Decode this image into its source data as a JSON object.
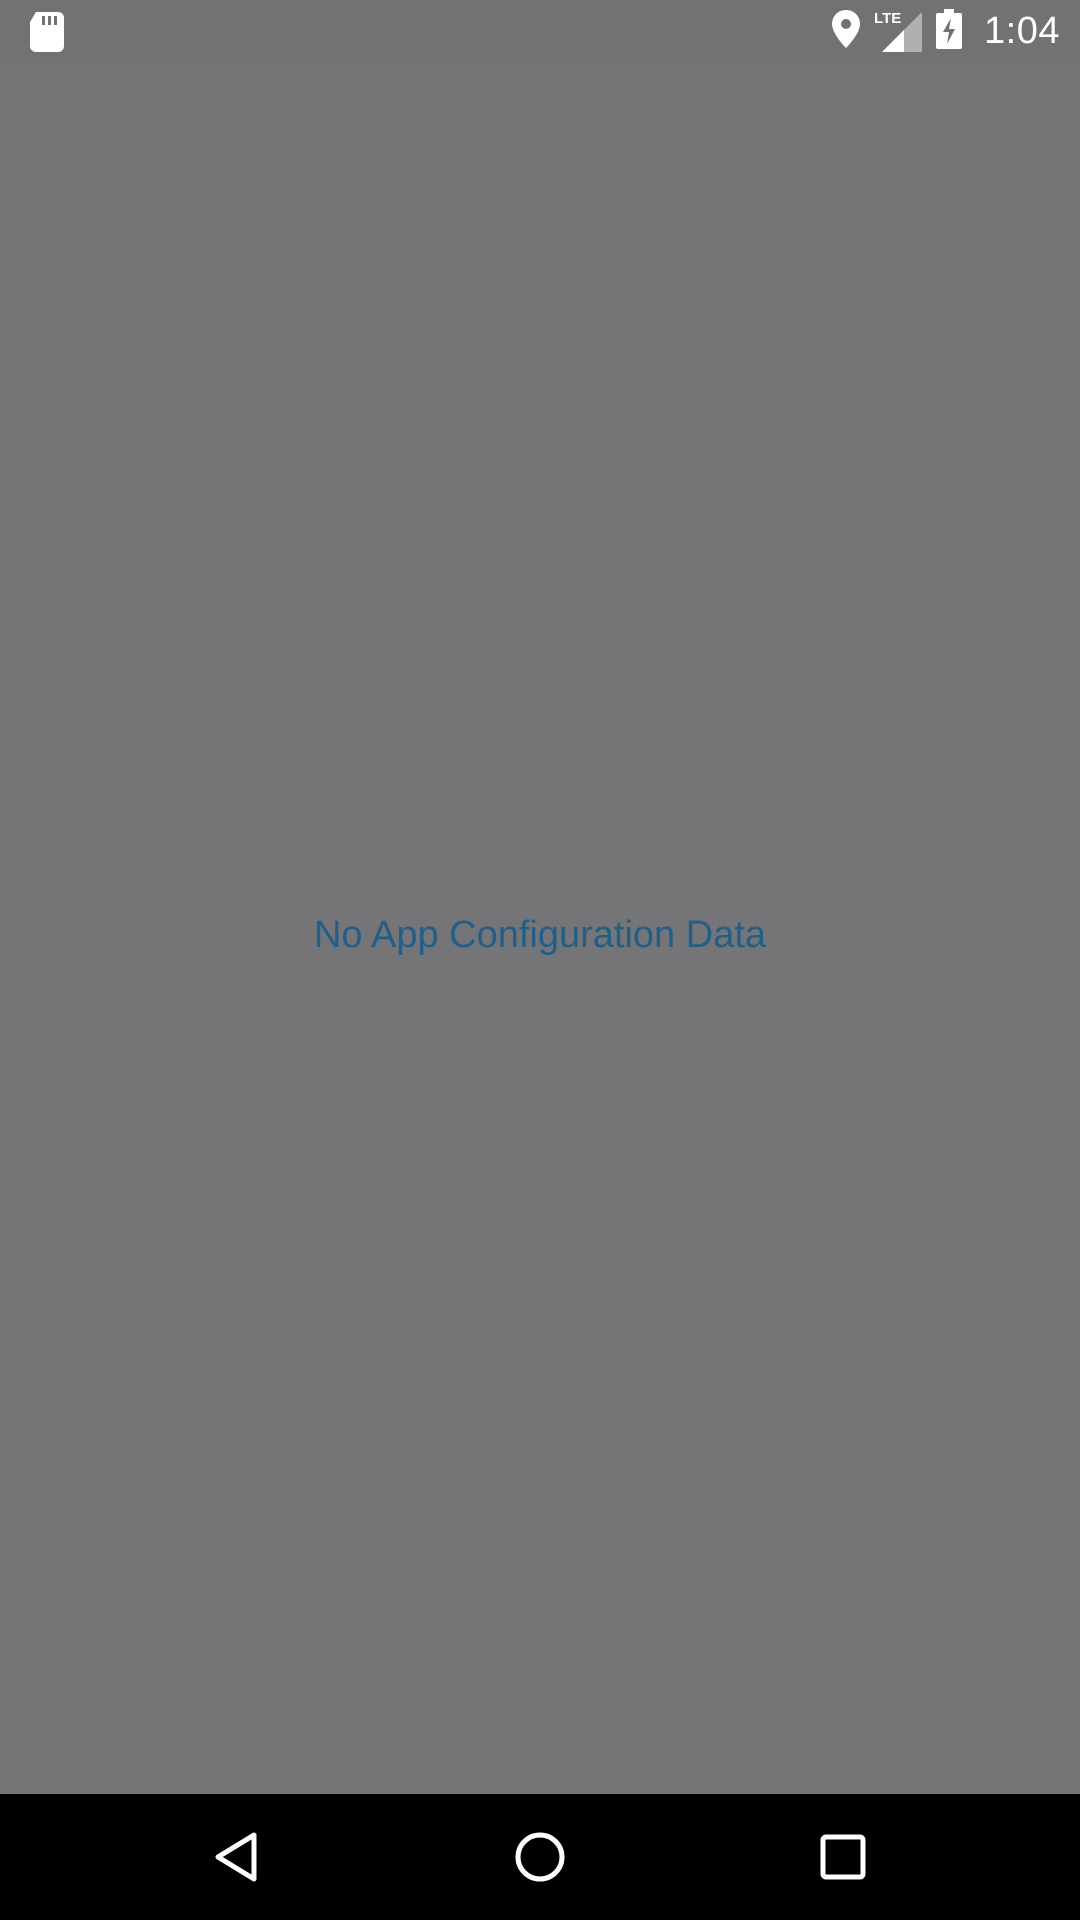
{
  "status_bar": {
    "time": "1:04",
    "network_label": "LTE",
    "icons": [
      "sd-card-icon",
      "location-icon",
      "signal-icon",
      "battery-charging-icon"
    ]
  },
  "main": {
    "empty_message": "No App Configuration Data",
    "message_color": "#1f5f8b",
    "background_color": "#757577"
  },
  "nav_bar": {
    "buttons": [
      "back",
      "home",
      "recents"
    ]
  }
}
